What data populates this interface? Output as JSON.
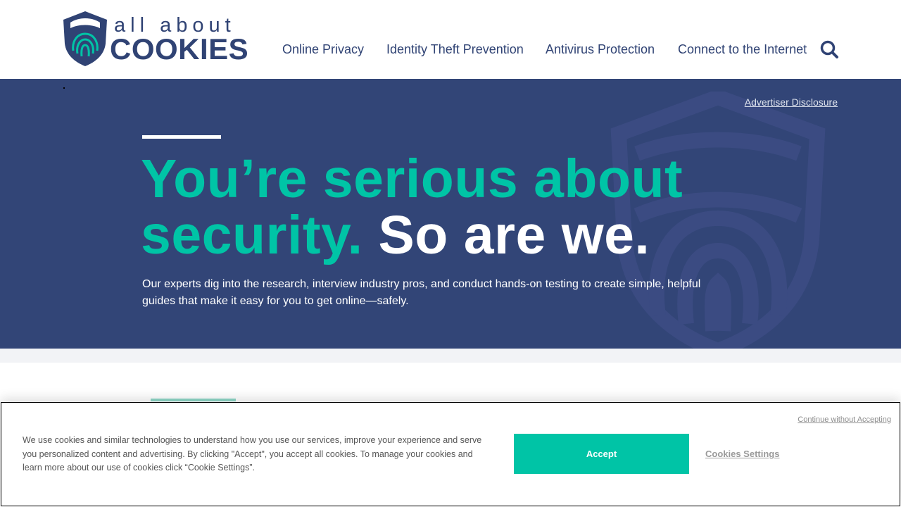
{
  "header": {
    "logo": {
      "top_text": "all about",
      "bottom_text": "COOKIES"
    },
    "nav": [
      {
        "label": "Online Privacy"
      },
      {
        "label": "Identity Theft Prevention"
      },
      {
        "label": "Antivirus Protection"
      },
      {
        "label": "Connect to the Internet"
      }
    ],
    "search_icon": "search-icon"
  },
  "hero": {
    "disclosure": "Advertiser Disclosure",
    "headline_teal": "You’re serious about security.",
    "headline_white": "So are we.",
    "description": "Our experts dig into the research, interview industry pros, and conduct hands-on testing to create simple, helpful guides that make it easy for you to get online—safely."
  },
  "cookie_banner": {
    "continue_label": "Continue without Accepting",
    "text": "We use cookies and similar technologies to understand how you use our services, improve your experience and serve you personalized content and advertising. By clicking \"Accept\", you accept all cookies. To manage your cookies and learn more about our use of cookies click “Cookie Settings”.",
    "accept_label": "Accept",
    "settings_label": "Cookies Settings"
  },
  "colors": {
    "brand_navy": "#324577",
    "brand_teal": "#00c4a6"
  }
}
